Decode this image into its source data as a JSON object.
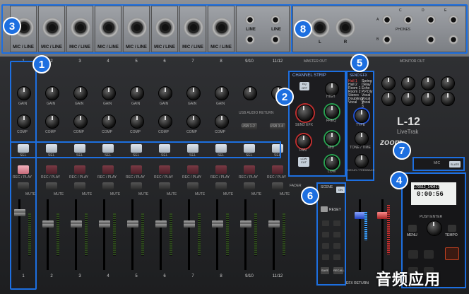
{
  "channels": [
    {
      "num": "1",
      "input_label": "MIC / LINE",
      "sel": "SEL",
      "rec": "REC / PLAY",
      "mute": "MUTE",
      "gain": "GAIN",
      "comp": "COMP"
    },
    {
      "num": "2",
      "input_label": "MIC / LINE",
      "sel": "SEL",
      "rec": "REC / PLAY",
      "mute": "MUTE",
      "gain": "GAIN",
      "comp": "COMP"
    },
    {
      "num": "3",
      "input_label": "MIC / LINE",
      "sel": "SEL",
      "rec": "REC / PLAY",
      "mute": "MUTE",
      "gain": "GAIN",
      "comp": "COMP"
    },
    {
      "num": "4",
      "input_label": "MIC / LINE",
      "sel": "SEL",
      "rec": "REC / PLAY",
      "mute": "MUTE",
      "gain": "GAIN",
      "comp": "COMP"
    },
    {
      "num": "5",
      "input_label": "MIC / LINE",
      "sel": "SEL",
      "rec": "REC / PLAY",
      "mute": "MUTE",
      "gain": "GAIN",
      "comp": "COMP"
    },
    {
      "num": "6",
      "input_label": "MIC / LINE",
      "sel": "SEL",
      "rec": "REC / PLAY",
      "mute": "MUTE",
      "gain": "GAIN",
      "comp": "COMP"
    },
    {
      "num": "7",
      "input_label": "MIC / LINE",
      "sel": "SEL",
      "rec": "REC / PLAY",
      "mute": "MUTE",
      "gain": "GAIN",
      "comp": "COMP"
    },
    {
      "num": "8",
      "input_label": "MIC / LINE",
      "sel": "SEL",
      "rec": "REC / PLAY",
      "mute": "MUTE",
      "gain": "GAIN",
      "comp": "COMP"
    }
  ],
  "stereo_channels": [
    {
      "num": "9/10",
      "input_label": "LINE",
      "sel": "SEL",
      "rec": "REC / PLAY",
      "mute": "MUTE",
      "usb": "USB 1-2"
    },
    {
      "num": "11/12",
      "input_label": "LINE",
      "sel": "SEL",
      "rec": "REC / PLAY",
      "mute": "MUTE",
      "usb": "USB 3-4"
    }
  ],
  "usb_audio_return": "USB AUDIO RETURN",
  "channel_strip": {
    "title": "CHANNEL STRIP",
    "eq": "EQ OFF",
    "high": "HIGH",
    "freq": "FREQ",
    "mid": "MID",
    "low": "LOW",
    "send_efx": "SEND EFX",
    "pan": "PAN",
    "low_cut": "LOW CUT"
  },
  "send_efx": {
    "title": "SEND EFX",
    "col1": [
      "Hall 1",
      "Hall 2",
      "Room 1",
      "Room 2",
      "Stereo",
      "Doubling",
      "Vocal"
    ],
    "col2": [
      "Spring",
      "Delay",
      "Echo",
      "P.P.Dly",
      "Vocal 1",
      "Vocal 2",
      "Vocal 3"
    ],
    "type": "TYPE",
    "tone": "TONE / TIME",
    "decay": "DECAY / FEEDBACK",
    "on": "ON"
  },
  "master": {
    "master_out": "MASTER OUT",
    "monitor_out": "MONITOR OUT",
    "brand": "zoom",
    "model": "L-12",
    "sub": "LiveTrak"
  },
  "scene": {
    "title": "SCENE",
    "reset": "RESET",
    "save": "SAVE",
    "recall": "RECALL",
    "fader": "FADER"
  },
  "recorder": {
    "mic": "MIC",
    "slate": "SLATE",
    "file": "170512_140417",
    "time": "0:00:56",
    "push_enter": "PUSH ENTER",
    "menu": "MENU",
    "tempo": "TEMPO"
  },
  "outputs": {
    "l": "L",
    "r": "R",
    "a": "A",
    "b": "B",
    "c": "C",
    "d": "D",
    "e": "E",
    "phones": "PHONES"
  },
  "efx_return": "EFX RETURN",
  "badges": [
    "1",
    "2",
    "3",
    "4",
    "5",
    "6",
    "7",
    "8"
  ],
  "watermark": "音频应用"
}
